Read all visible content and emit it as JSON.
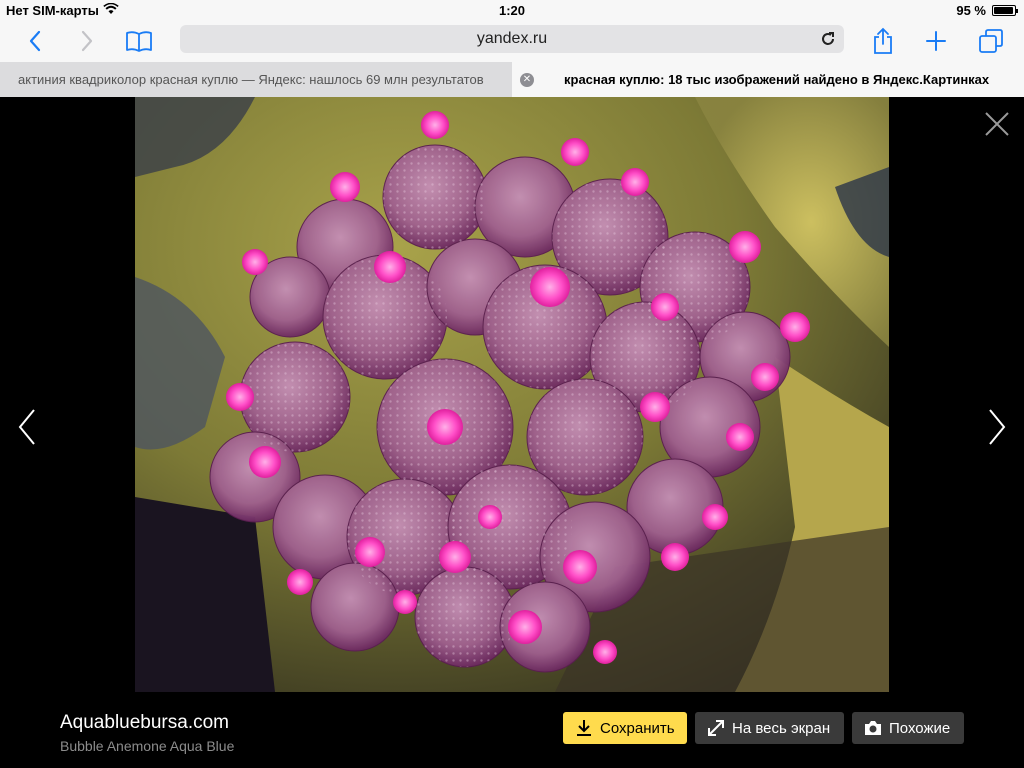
{
  "status": {
    "carrier": "Нет SIM-карты",
    "time": "1:20",
    "battery": "95 %",
    "battery_level": 0.95
  },
  "toolbar": {
    "url": "yandex.ru"
  },
  "tabs": [
    {
      "label": "актиния квадриколор красная куплю — Яндекс: нашлось 69 млн результатов",
      "active": false
    },
    {
      "label": "красная куплю: 18 тыс изображений найдено в Яндекс.Картинках",
      "active": true
    }
  ],
  "viewer": {
    "source_site": "Aquabluebursa.com",
    "image_title": "Bubble Anemone Aqua Blue",
    "buttons": {
      "save": "Сохранить",
      "fullscreen": "На весь экран",
      "similar": "Похожие"
    }
  },
  "colors": {
    "accent": "#1a7cf5",
    "save_button": "#ffdb4d",
    "dark_button": "#3a3a3a"
  }
}
